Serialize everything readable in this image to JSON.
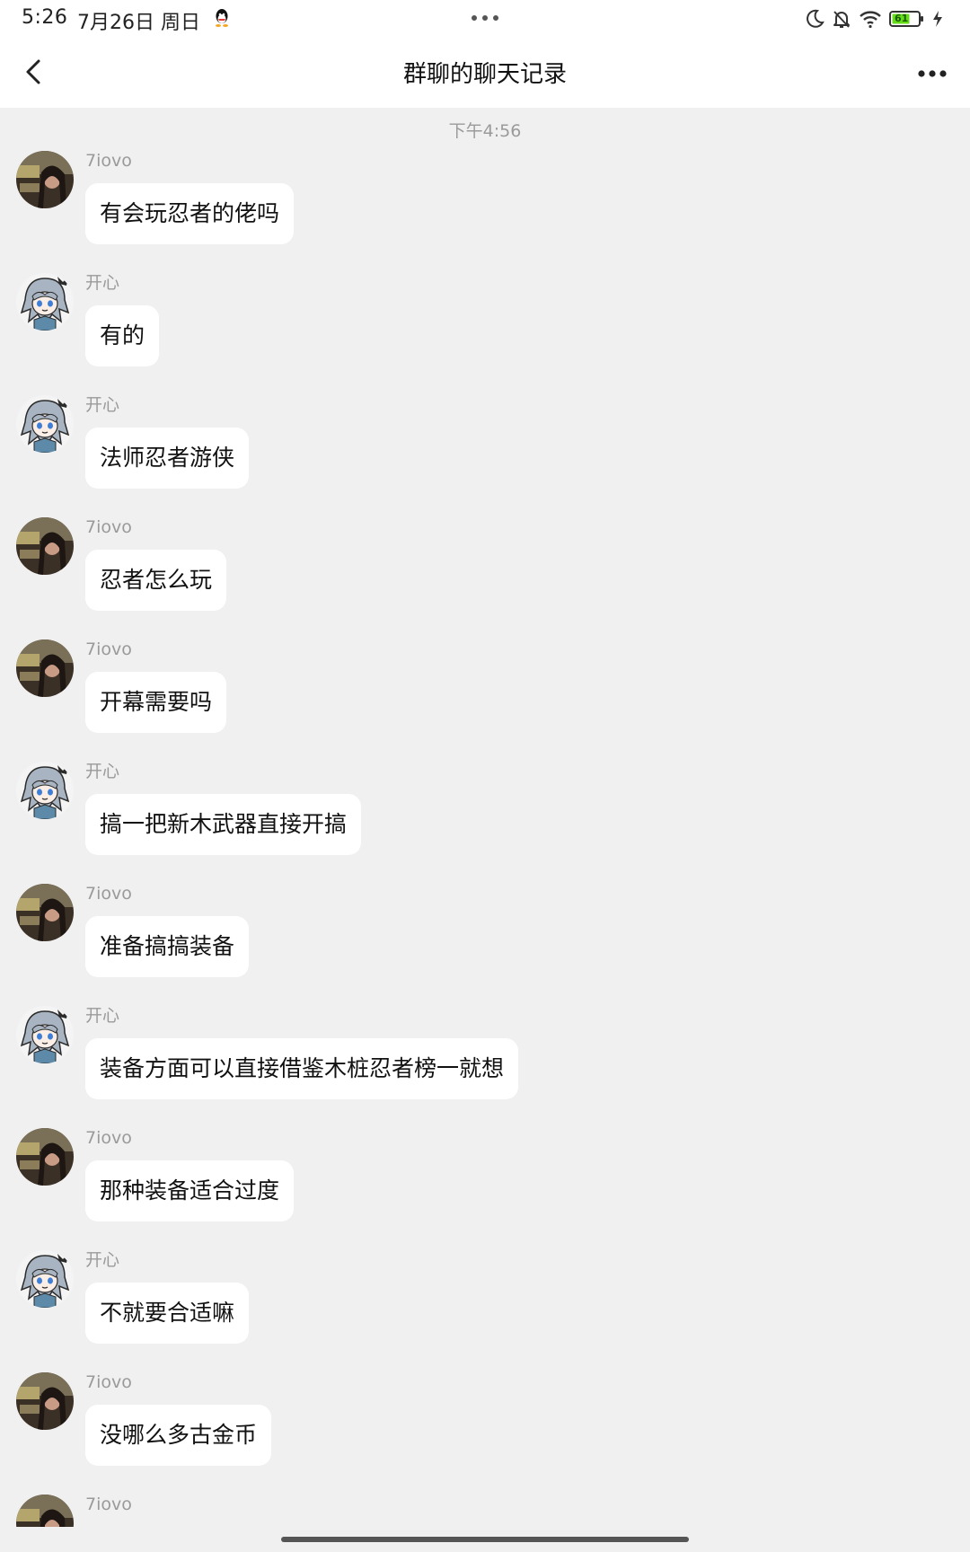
{
  "status_bar": {
    "time": "5:26",
    "date": "7月26日 周日",
    "battery": "61",
    "icons": [
      "qq-icon",
      "more-dots-icon",
      "moon-icon",
      "bell-off-icon",
      "wifi-icon",
      "battery-icon",
      "charging-icon"
    ]
  },
  "header": {
    "title": "群聊的聊天记录",
    "back_icon": "chevron-left-icon",
    "more_icon": "more-horizontal-icon"
  },
  "chat": {
    "time_divider": "下午4:56",
    "messages": [
      {
        "sender": "7iovo",
        "text": "有会玩忍者的佬吗",
        "avatar": "photo"
      },
      {
        "sender": "开心",
        "text": "有的",
        "avatar": "anime"
      },
      {
        "sender": "开心",
        "text": "法师忍者游侠",
        "avatar": "anime"
      },
      {
        "sender": "7iovo",
        "text": "忍者怎么玩",
        "avatar": "photo"
      },
      {
        "sender": "7iovo",
        "text": "开幕需要吗",
        "avatar": "photo"
      },
      {
        "sender": "开心",
        "text": "搞一把新木武器直接开搞",
        "avatar": "anime"
      },
      {
        "sender": "7iovo",
        "text": "准备搞搞装备",
        "avatar": "photo"
      },
      {
        "sender": "开心",
        "text": "装备方面可以直接借鉴木桩忍者榜一就想",
        "avatar": "anime"
      },
      {
        "sender": "7iovo",
        "text": "那种装备适合过度",
        "avatar": "photo"
      },
      {
        "sender": "开心",
        "text": "不就要合适嘛",
        "avatar": "anime"
      },
      {
        "sender": "7iovo",
        "text": "没哪么多古金币",
        "avatar": "photo"
      },
      {
        "sender": "7iovo",
        "text": "",
        "avatar": "photo"
      }
    ]
  }
}
